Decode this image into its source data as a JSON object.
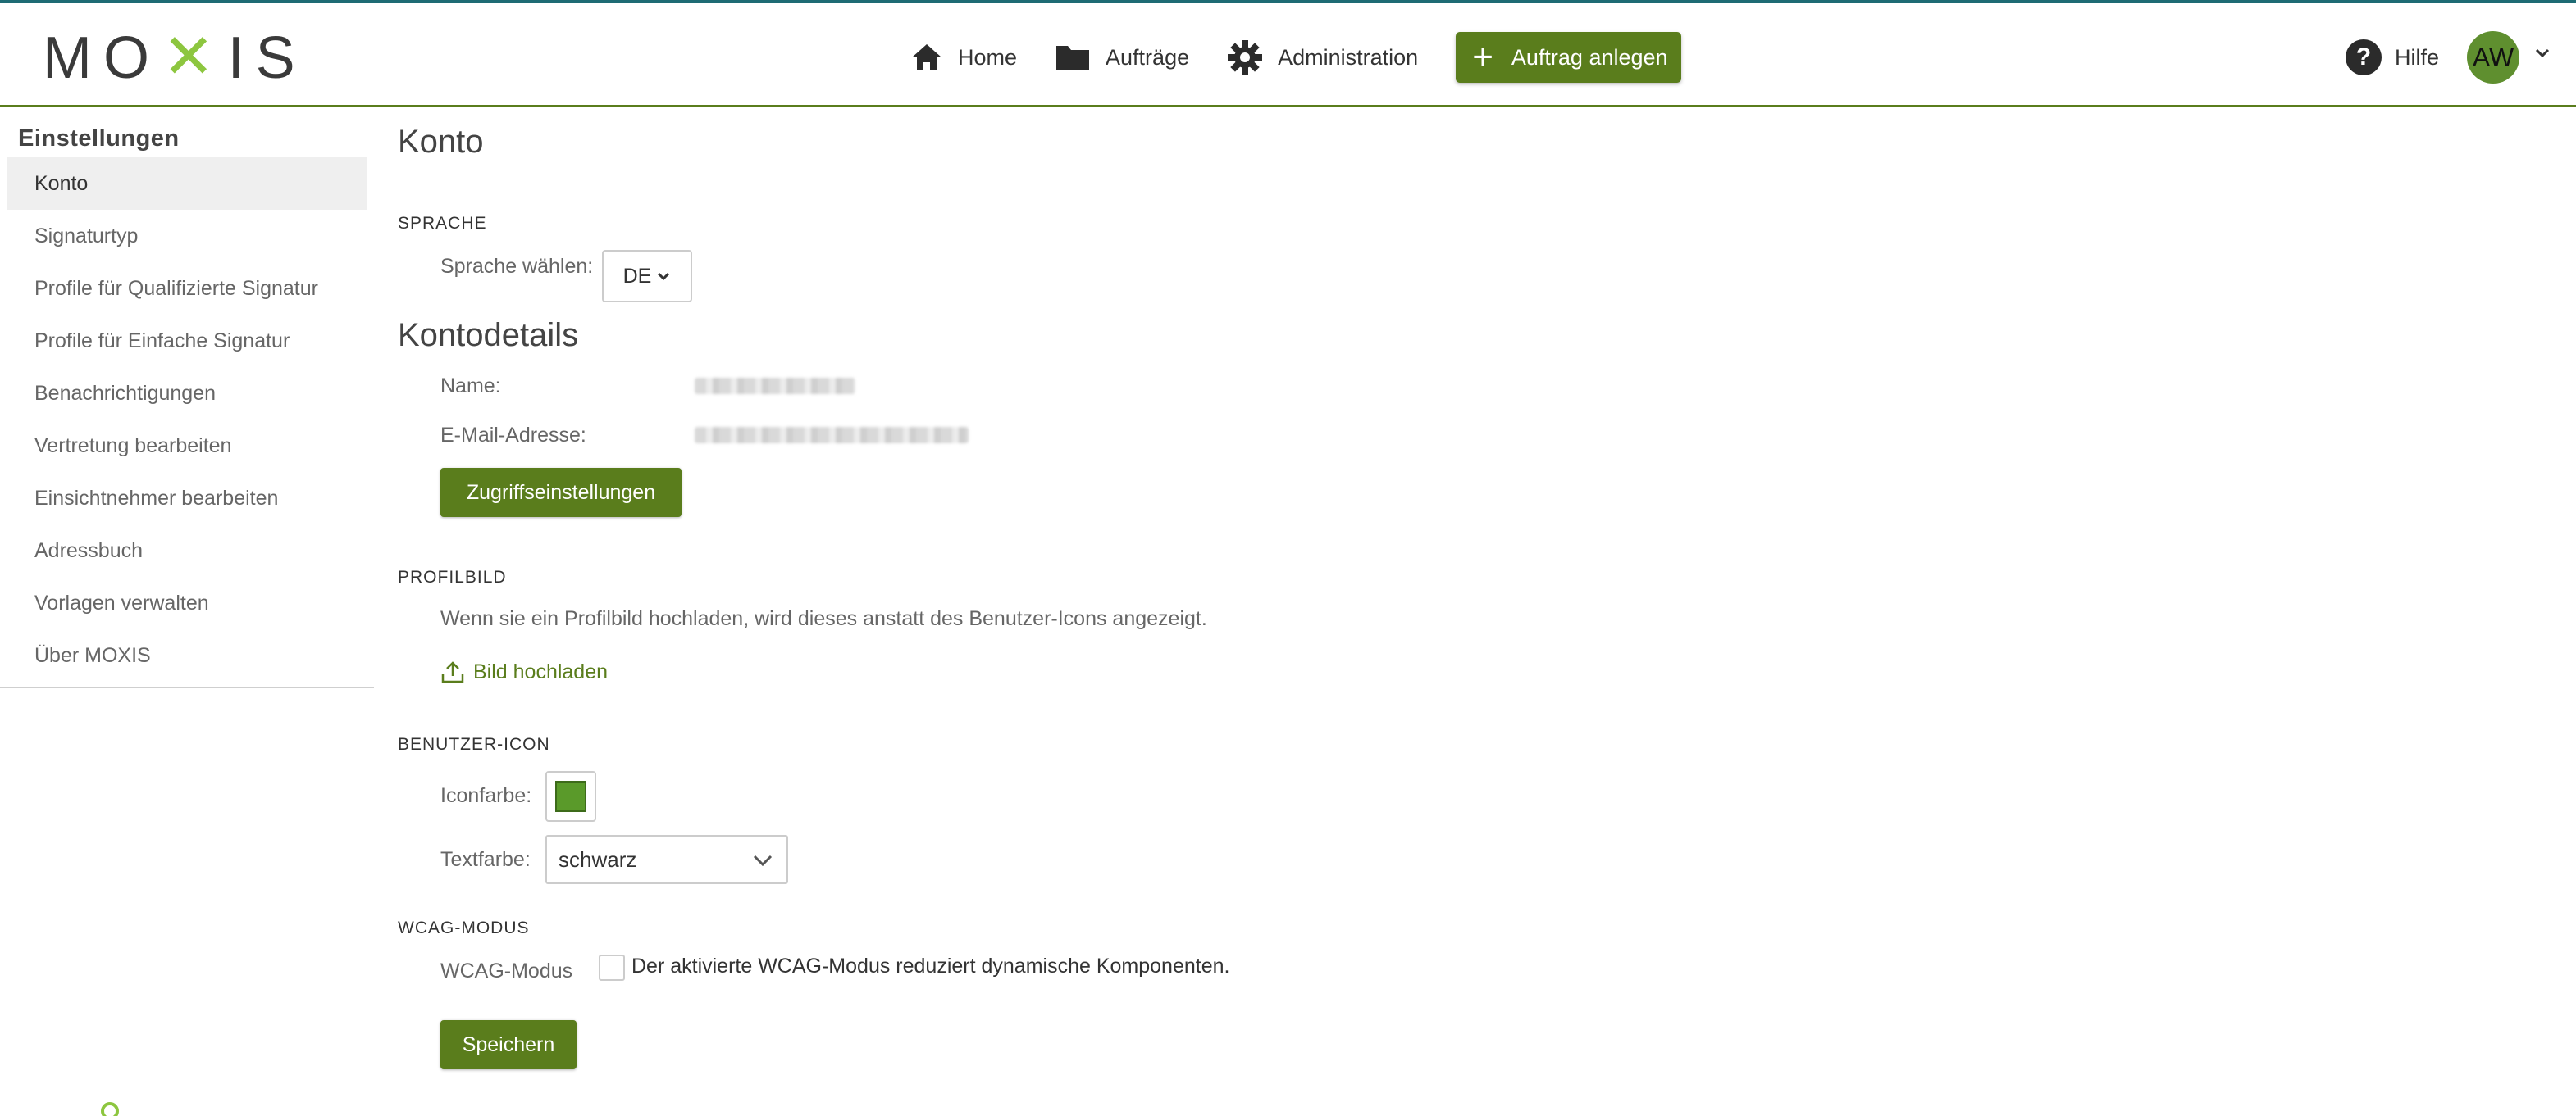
{
  "header": {
    "logo": "MOXIS",
    "nav": {
      "home": "Home",
      "orders": "Aufträge",
      "admin": "Administration",
      "create": "Auftrag anlegen"
    },
    "help": "Hilfe",
    "avatar_initials": "AW"
  },
  "sidebar": {
    "title": "Einstellungen",
    "items": [
      {
        "label": "Konto"
      },
      {
        "label": "Signaturtyp"
      },
      {
        "label": "Profile für Qualifizierte Signatur"
      },
      {
        "label": "Profile für Einfache Signatur"
      },
      {
        "label": "Benachrichtigungen"
      },
      {
        "label": "Vertretung bearbeiten"
      },
      {
        "label": "Einsichtnehmer bearbeiten"
      },
      {
        "label": "Adressbuch"
      },
      {
        "label": "Vorlagen verwalten"
      },
      {
        "label": "Über MOXIS"
      }
    ]
  },
  "main": {
    "title": "Konto",
    "language": {
      "heading": "SPRACHE",
      "label": "Sprache wählen:",
      "value": "DE"
    },
    "account": {
      "heading": "Kontodetails",
      "name_label": "Name:",
      "email_label": "E-Mail-Adresse:",
      "access_button": "Zugriffseinstellungen"
    },
    "profile": {
      "heading": "PROFILBILD",
      "description": "Wenn sie ein Profilbild hochladen, wird dieses anstatt des Benutzer-Icons angezeigt.",
      "upload_link": "Bild hochladen"
    },
    "user_icon": {
      "heading": "BENUTZER-ICON",
      "icon_color_label": "Iconfarbe:",
      "icon_color": "#5a9a2a",
      "text_color_label": "Textfarbe:",
      "text_color_value": "schwarz"
    },
    "wcag": {
      "heading": "WCAG-MODUS",
      "label": "WCAG-Modus",
      "checkbox_text": "Der aktivierte WCAG-Modus reduziert dynamische Komponenten.",
      "checked": false
    },
    "save_button": "Speichern"
  },
  "colors": {
    "brand_green": "#5a7d1c",
    "accent_green": "#8dc63f",
    "top_line": "#1e6b74"
  }
}
